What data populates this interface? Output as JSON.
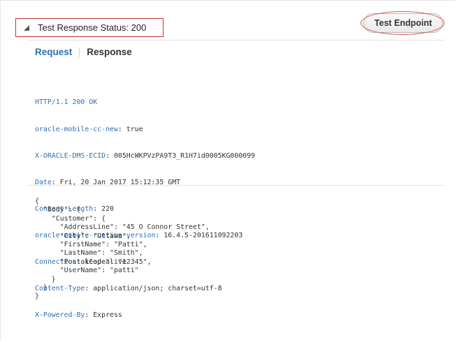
{
  "header": {
    "title": "Test Response Status: 200",
    "toggle_icon": "collapse-triangle-icon"
  },
  "toolbar": {
    "test_button_label": "Test Endpoint"
  },
  "tabs": {
    "request": "Request",
    "response": "Response",
    "active": "Request"
  },
  "response": {
    "status_line": "HTTP/1.1 200 OK",
    "headers": [
      {
        "key": "oracle-mobile-cc-new",
        "value": "true"
      },
      {
        "key": "X-ORACLE-DMS-ECID",
        "value": "005HcWKPVzPA9T3_R1H7id0005KG000099"
      },
      {
        "key": "Date",
        "value": "Fri, 20 Jan 2017 15:12:35 GMT"
      },
      {
        "key": "Content-Length",
        "value": "220"
      },
      {
        "key": "oracle-mobile-runtime-version",
        "value": "16.4.5-201611092203"
      },
      {
        "key": "Connection",
        "value": "keep-alive"
      },
      {
        "key": "Content-Type",
        "value": "application/json; charset=utf-8"
      },
      {
        "key": "X-Powered-By",
        "value": "Express"
      }
    ],
    "body": "{\n  \"Body\": {\n    \"Customer\": {\n      \"AddressLine\": \"45 O Connor Street\",\n      \"City\": \"Ottawa\",\n      \"FirstName\": \"Patti\",\n      \"LastName\": \"Smith\",\n      \"PostalCode\": \"12345\",\n      \"UserName\": \"patti\"\n    }\n  }\n}"
  },
  "colors": {
    "link_blue": "#2f6fb5",
    "highlight_red": "#c9302c"
  }
}
